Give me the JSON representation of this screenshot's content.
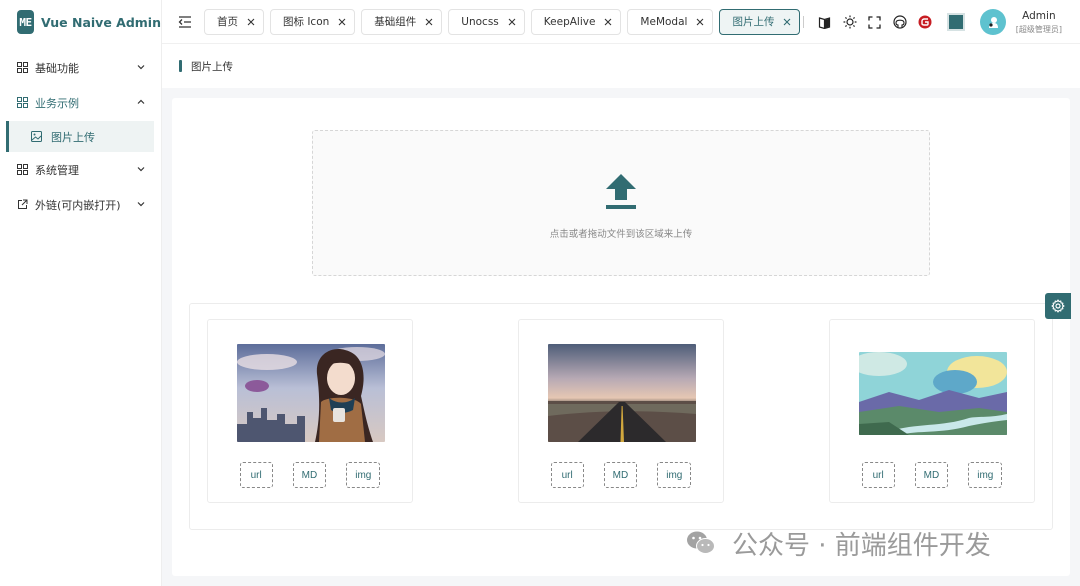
{
  "brand": {
    "logo_text": "ME",
    "name": "Vue Naive Admin"
  },
  "sidebar": {
    "items": [
      {
        "label": "基础功能",
        "icon": "grid-icon",
        "expanded": false
      },
      {
        "label": "业务示例",
        "icon": "grid-icon",
        "expanded": true,
        "children": [
          {
            "label": "图片上传",
            "icon": "image-icon",
            "active": true
          }
        ]
      },
      {
        "label": "系统管理",
        "icon": "grid-icon",
        "expanded": false
      },
      {
        "label": "外链(可内嵌打开)",
        "icon": "external-link-icon",
        "expanded": false
      }
    ]
  },
  "tabs": [
    {
      "label": "首页",
      "active": false
    },
    {
      "label": "图标 Icon",
      "active": false
    },
    {
      "label": "基础组件",
      "active": false
    },
    {
      "label": "Unocss",
      "active": false
    },
    {
      "label": "KeepAlive",
      "active": false
    },
    {
      "label": "MeModal",
      "active": false
    },
    {
      "label": "图片上传",
      "active": true
    }
  ],
  "header_icons": [
    "book-icon",
    "sun-icon",
    "fullscreen-icon",
    "github-icon",
    "gitee-icon"
  ],
  "theme": {
    "accent": "#316c72"
  },
  "user": {
    "name": "Admin",
    "role": "[超级管理员]"
  },
  "breadcrumb": {
    "title": "图片上传"
  },
  "upload": {
    "hint": "点击或者拖动文件到该区域来上传"
  },
  "images": [
    {
      "buttons": [
        "url",
        "MD",
        "img"
      ]
    },
    {
      "buttons": [
        "url",
        "MD",
        "img"
      ]
    },
    {
      "buttons": [
        "url",
        "MD",
        "img"
      ]
    }
  ],
  "watermark": {
    "text": "公众号 · 前端组件开发"
  }
}
